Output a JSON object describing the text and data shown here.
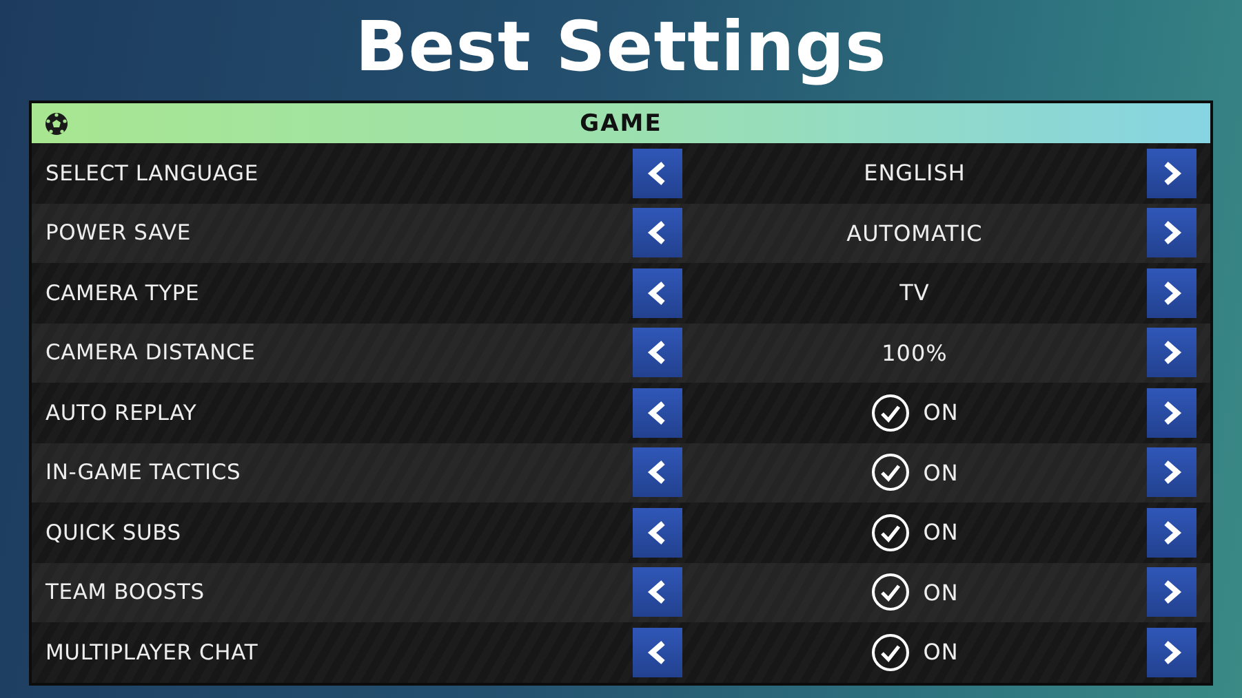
{
  "title": "Best Settings",
  "panel": {
    "heading": "GAME",
    "rows": [
      {
        "label": "SELECT LANGUAGE",
        "kind": "text",
        "value": "ENGLISH"
      },
      {
        "label": "POWER SAVE",
        "kind": "text",
        "value": "AUTOMATIC"
      },
      {
        "label": "CAMERA TYPE",
        "kind": "text",
        "value": "TV"
      },
      {
        "label": "CAMERA DISTANCE",
        "kind": "text",
        "value": "100%"
      },
      {
        "label": "AUTO REPLAY",
        "kind": "toggle",
        "checked": true,
        "value": "ON"
      },
      {
        "label": "IN-GAME TACTICS",
        "kind": "toggle",
        "checked": true,
        "value": "ON"
      },
      {
        "label": "QUICK SUBS",
        "kind": "toggle",
        "checked": true,
        "value": "ON"
      },
      {
        "label": "TEAM BOOSTS",
        "kind": "toggle",
        "checked": true,
        "value": "ON"
      },
      {
        "label": "MULTIPLAYER CHAT",
        "kind": "toggle",
        "checked": true,
        "value": "ON"
      }
    ]
  }
}
